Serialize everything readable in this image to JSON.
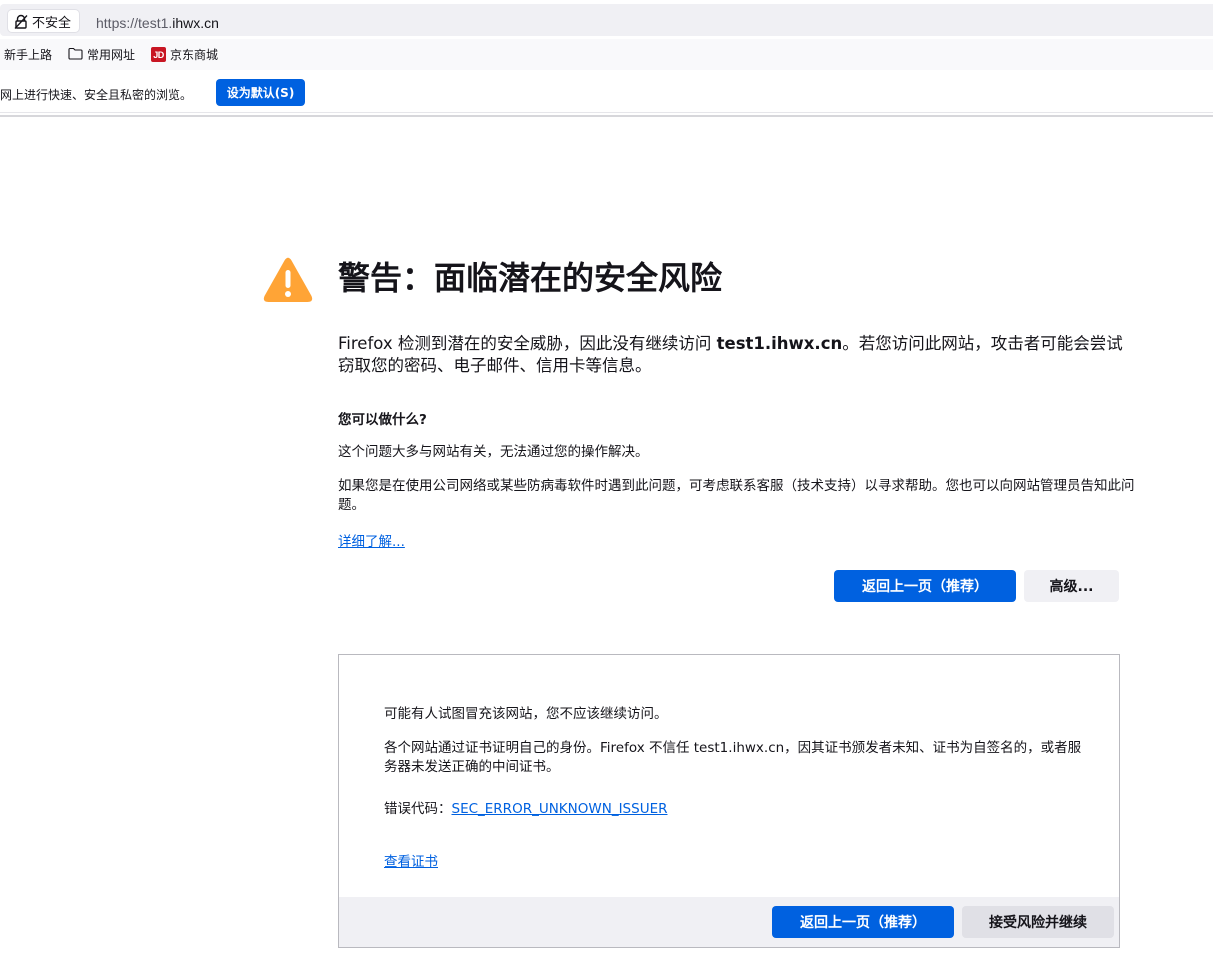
{
  "browser": {
    "identity_label": "不安全",
    "url_prefix": "https://test1.",
    "url_domain": "ihwx.cn",
    "bookmarks": [
      {
        "label": "新手上路",
        "icon": "none"
      },
      {
        "label": "常用网址",
        "icon": "folder-icon"
      },
      {
        "label": "京东商城",
        "icon": "jd-logo",
        "logo_text": "JD"
      }
    ],
    "notification": {
      "text": "在网上进行快速、安全且私密的浏览。",
      "button_label": "设为默认(S)"
    }
  },
  "error_page": {
    "title": "警告：面临潜在的安全风险",
    "intro_before": "Firefox 检测到潜在的安全威胁，因此没有继续访问 ",
    "intro_host": "test1.ihwx.cn",
    "intro_after": "。若您访问此网站，攻击者可能会尝试窃取您的密码、电子邮件、信用卡等信息。",
    "what_can_do_heading": "您可以做什么?",
    "what_can_do_p1": "这个问题大多与网站有关，无法通过您的操作解决。",
    "what_can_do_p2": "如果您是在使用公司网络或某些防病毒软件时遇到此问题，可考虑联系客服（技术支持）以寻求帮助。您也可以向网站管理员告知此问题。",
    "learn_more_link": "详细了解...",
    "go_back_button": "返回上一页（推荐）",
    "advanced_button": "高级...",
    "advanced_panel": {
      "p1": "可能有人试图冒充该网站，您不应该继续访问。",
      "p2": "各个网站通过证书证明自己的身份。Firefox 不信任 test1.ihwx.cn，因其证书颁发者未知、证书为自签名的，或者服务器未发送正确的中间证书。",
      "error_code_label": "错误代码：",
      "error_code": "SEC_ERROR_UNKNOWN_ISSUER",
      "view_cert_link": "查看证书",
      "go_back_button": "返回上一页（推荐）",
      "accept_button": "接受风险并继续"
    }
  },
  "colors": {
    "accent": "#0061e0",
    "warning": "#ffa436",
    "text": "#15141a",
    "secondary_button": "#f0f0f4"
  }
}
